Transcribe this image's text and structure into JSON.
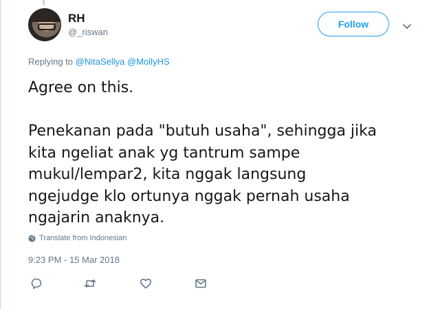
{
  "author": {
    "name": "RH",
    "handle": "@_riswan"
  },
  "follow_label": "Follow",
  "replying": {
    "prefix": "Replying to",
    "mentions": [
      "@NitaSellya",
      "@MollyHS"
    ]
  },
  "tweet": {
    "lines_p1": [
      "Agree on this."
    ],
    "lines_p2": [
      "Penekanan pada \"butuh usaha\", sehingga jika",
      "kita ngeliat anak yg tantrum sampe",
      "mukul/lempar2, kita nggak langsung",
      "ngejudge klo ortunya nggak pernah usaha",
      "ngajarin anaknya."
    ]
  },
  "translate_label": "Translate from Indonesian",
  "timestamp": "9:23 PM - 15 Mar 2018",
  "actions": [
    "reply-icon",
    "retweet-icon",
    "like-icon",
    "message-icon"
  ],
  "colors": {
    "accent": "#1da1f2",
    "link": "#1b95e0",
    "muted": "#657786",
    "text": "#14171a"
  }
}
